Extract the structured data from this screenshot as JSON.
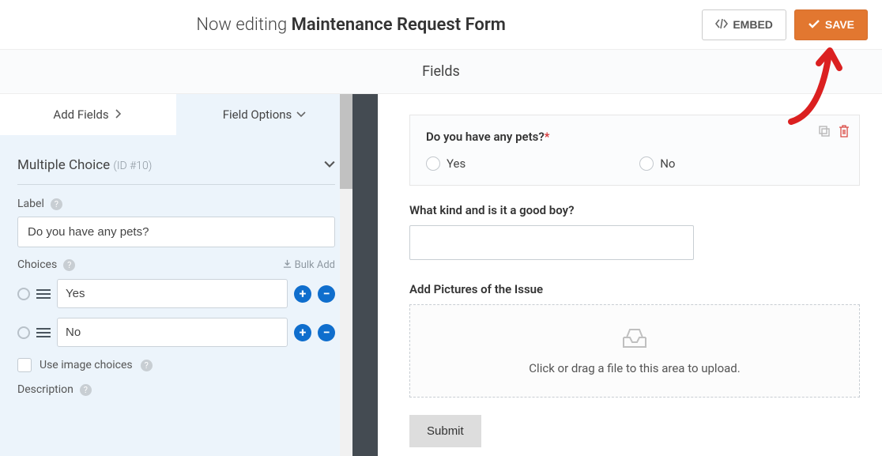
{
  "header": {
    "prefix": "Now editing ",
    "form_name": "Maintenance Request Form",
    "embed_label": "EMBED",
    "save_label": "SAVE"
  },
  "fields_bar": {
    "title": "Fields"
  },
  "tabs": {
    "add_fields": "Add Fields",
    "field_options": "Field Options"
  },
  "panel": {
    "type_label": "Multiple Choice",
    "id_label": "(ID #10)",
    "label_heading": "Label",
    "label_value": "Do you have any pets?",
    "choices_heading": "Choices",
    "bulk_add": "Bulk Add",
    "choices": [
      "Yes",
      "No"
    ],
    "image_choices": "Use image choices",
    "description": "Description"
  },
  "preview": {
    "q1_label": "Do you have any pets?",
    "q1_options": [
      "Yes",
      "No"
    ],
    "q2_label": "What kind and is it a good boy?",
    "q3_label": "Add Pictures of the Issue",
    "upload_hint": "Click or drag a file to this area to upload.",
    "submit": "Submit"
  }
}
